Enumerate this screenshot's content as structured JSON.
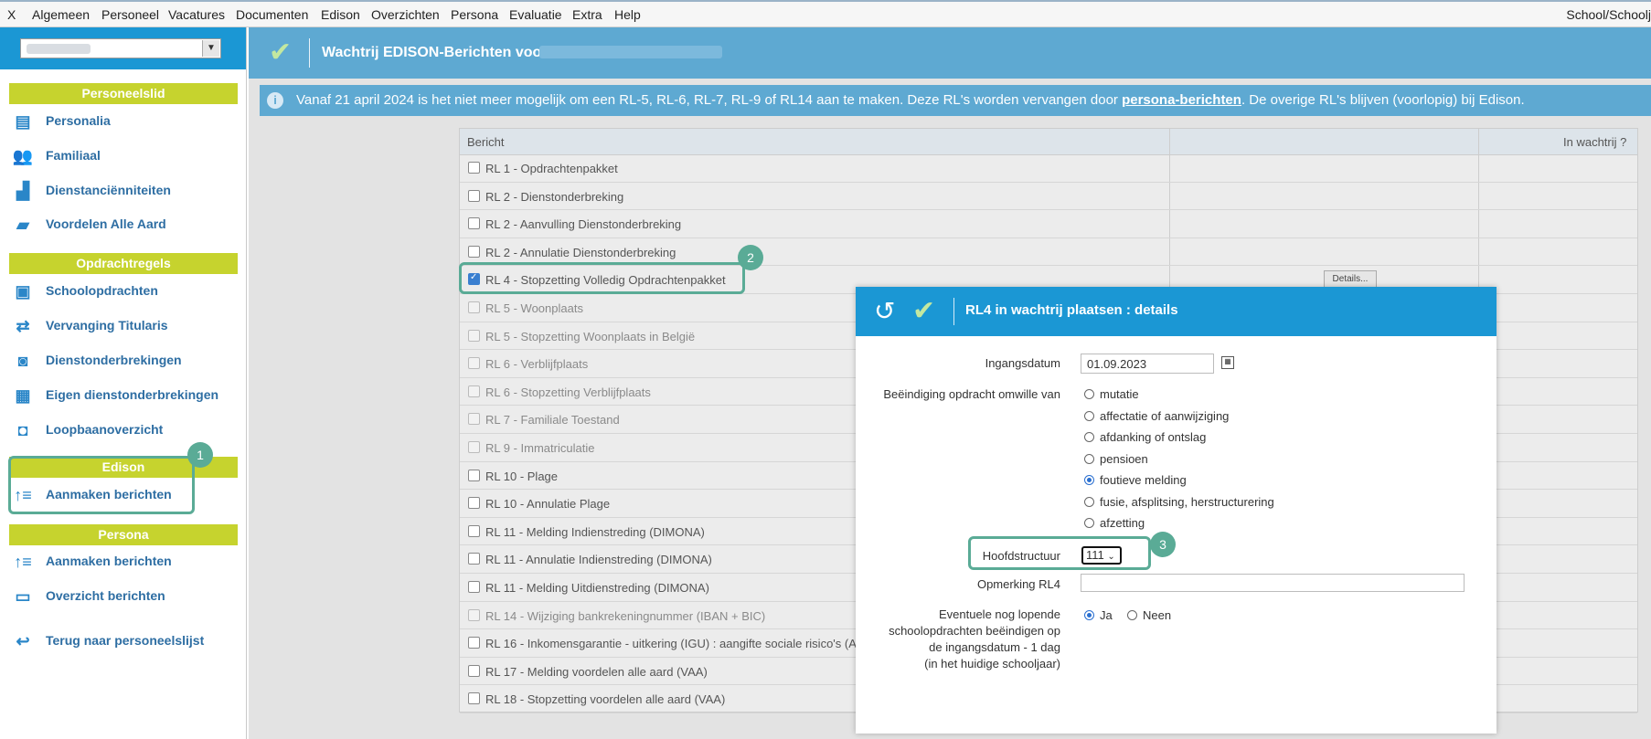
{
  "menubar": {
    "items": [
      "X",
      "Algemeen",
      "Personeel",
      "Vacatures",
      "Documenten",
      "Edison",
      "Overzichten",
      "Persona",
      "Evaluatie",
      "Extra",
      "Help"
    ],
    "right_label": "School/Schoolj"
  },
  "sidebar": {
    "sections": {
      "personeelslid": "Personeelslid",
      "opdrachtregels": "Opdrachtregels",
      "edison": "Edison",
      "persona": "Persona"
    },
    "items": [
      {
        "label": "Personalia",
        "icon": "id-card-icon"
      },
      {
        "label": "Familiaal",
        "icon": "people-icon"
      },
      {
        "label": "Dienstanciënniteiten",
        "icon": "podium-icon"
      },
      {
        "label": "Voordelen Alle Aard",
        "icon": "wallet-icon"
      },
      {
        "label": "Schoolopdrachten",
        "icon": "teacher-icon"
      },
      {
        "label": "Vervanging Titularis",
        "icon": "swap-icon"
      },
      {
        "label": "Dienstonderbrekingen",
        "icon": "briefcase-clock-icon"
      },
      {
        "label": "Eigen dienstonderbrekingen",
        "icon": "calendar-clock-icon"
      },
      {
        "label": "Loopbaanoverzicht",
        "icon": "briefcase-icon"
      },
      {
        "label": "Aanmaken berichten",
        "icon": "sort-up-icon"
      },
      {
        "label": "Aanmaken berichten",
        "icon": "sort-up-icon"
      },
      {
        "label": "Overzicht berichten",
        "icon": "message-icon"
      },
      {
        "label": "Terug naar personeelslijst",
        "icon": "return-icon"
      }
    ]
  },
  "main": {
    "title": "Wachtrij EDISON-Berichten voor",
    "info": {
      "before": "Vanaf 21 april 2024 is het niet meer mogelijk om een RL-5, RL-6, RL-7, RL-9 of RL14 aan te maken. Deze RL's worden vervangen door ",
      "link": "persona-berichten",
      "after": ". De overige RL's blijven (voorlopig) bij Edison."
    },
    "table": {
      "col_bericht": "Bericht",
      "col_wachtrij": "In wachtrij ?",
      "details_label": "Details...",
      "rows": [
        "RL 1 - Opdrachtenpakket",
        "RL 2 - Dienstonderbreking",
        "RL 2 - Aanvulling Dienstonderbreking",
        "RL 2 - Annulatie Dienstonderbreking",
        "RL 4 - Stopzetting Volledig Opdrachtenpakket",
        "RL 5 - Woonplaats",
        "RL 5 - Stopzetting Woonplaats in België",
        "RL 6 - Verblijfplaats",
        "RL 6 - Stopzetting Verblijfplaats",
        "RL 7 - Familiale Toestand",
        "RL 9 - Immatriculatie",
        "RL 10 - Plage",
        "RL 10 - Annulatie Plage",
        "RL 11 - Melding Indienstreding (DIMONA)",
        "RL 11 - Annulatie Indienstreding (DIMONA)",
        "RL 11 - Melding Uitdienstreding (DIMONA)",
        "RL 14 - Wijziging bankrekeningnummer (IBAN + BIC)",
        "RL 16 - Inkomensgarantie - uitkering (IGU) : aangifte sociale risico's (A",
        "RL 17 - Melding voordelen alle aard (VAA)",
        "RL 18 - Stopzetting voordelen alle aard (VAA)"
      ]
    }
  },
  "dialog": {
    "title": "RL4 in wachtrij plaatsen : details",
    "ingangsdatum_label": "Ingangsdatum",
    "ingangsdatum_value": "01.09.2023",
    "beeindiging_label": "Beëindiging opdracht omwille van",
    "options": [
      "mutatie",
      "affectatie of aanwijziging",
      "afdanking of ontslag",
      "pensioen",
      "foutieve melding",
      "fusie, afsplitsing, herstructurering",
      "afzetting"
    ],
    "selected_option": "foutieve melding",
    "hoofdstructuur_label": "Hoofdstructuur",
    "hoofdstructuur_value": "111",
    "opmerking_label": "Opmerking RL4",
    "lopende_label_1": "Eventuele nog lopende",
    "lopende_label_2": "schoolopdrachten beëindigen op",
    "lopende_label_3": "de ingangsdatum - 1 dag",
    "lopende_label_4": "(in het huidige schooljaar)",
    "ja": "Ja",
    "neen": "Neen"
  },
  "callouts": [
    "1",
    "2",
    "3"
  ],
  "colors": {
    "accent_blue": "#1b97d4",
    "header_blue": "#5ea9d2",
    "section_green": "#c6d32e",
    "callout_teal": "#5aab96"
  }
}
